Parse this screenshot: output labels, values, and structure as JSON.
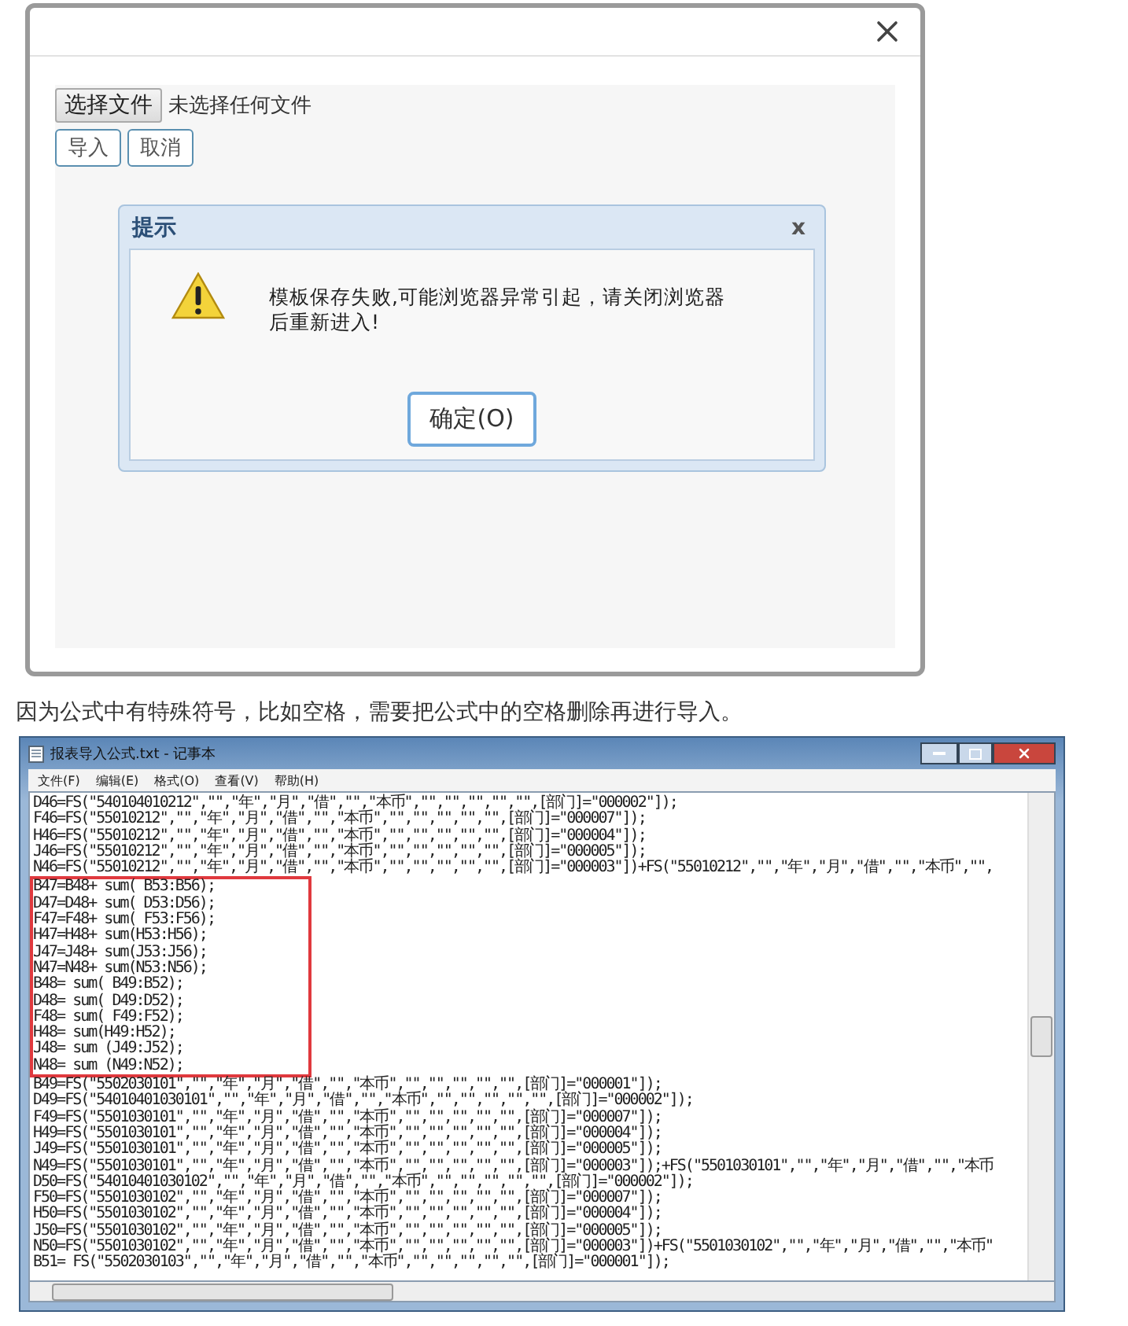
{
  "import_dialog": {
    "file_button": "选择文件",
    "file_status": "未选择任何文件",
    "buttons": [
      "导入",
      "取消"
    ],
    "alert": {
      "title": "提示",
      "close": "x",
      "message": "模板保存失败,可能浏览器异常引起，请关闭浏览器后重新进入!",
      "ok": "确定(O)"
    }
  },
  "caption": "因为公式中有特殊符号，比如空格，需要把公式中的空格删除再进行导入。",
  "notepad": {
    "title": "报表导入公式.txt - 记事本",
    "menu": [
      "文件(F)",
      "编辑(E)",
      "格式(O)",
      "查看(V)",
      "帮助(H)"
    ],
    "blocks": [
      {
        "highlighted": false,
        "lines": [
          "D46=FS(\"540104010212\",\"\",\"年\",\"月\",\"借\",\"\",\"本币\",\"\",\"\",\"\",\"\",\"\",[部门]=\"000002\"]);",
          "F46=FS(\"55010212\",\"\",\"年\",\"月\",\"借\",\"\",\"本币\",\"\",\"\",\"\",\"\",\"\",[部门]=\"000007\"]);",
          "H46=FS(\"55010212\",\"\",\"年\",\"月\",\"借\",\"\",\"本币\",\"\",\"\",\"\",\"\",\"\",[部门]=\"000004\"]);",
          "J46=FS(\"55010212\",\"\",\"年\",\"月\",\"借\",\"\",\"本币\",\"\",\"\",\"\",\"\",\"\",[部门]=\"000005\"]);",
          "N46=FS(\"55010212\",\"\",\"年\",\"月\",\"借\",\"\",\"本币\",\"\",\"\",\"\",\"\",\"\",[部门]=\"000003\"])+FS(\"55010212\",\"\",\"年\",\"月\",\"借\",\"\",\"本币\",\"\","
        ]
      },
      {
        "highlighted": true,
        "lines": [
          "B47=B48+ sum( B53:B56);",
          "D47=D48+ sum( D53:D56);",
          "F47=F48+ sum( F53:F56);",
          "H47=H48+ sum(H53:H56);",
          "J47=J48+ sum(J53:J56);",
          "N47=N48+ sum(N53:N56);",
          "B48= sum( B49:B52);",
          "D48= sum( D49:D52);",
          "F48= sum( F49:F52);",
          "H48= sum(H49:H52);",
          "J48= sum (J49:J52);",
          "N48= sum (N49:N52);"
        ]
      },
      {
        "highlighted": false,
        "lines": [
          "B49=FS(\"5502030101\",\"\",\"年\",\"月\",\"借\",\"\",\"本币\",\"\",\"\",\"\",\"\",\"\",[部门]=\"000001\"]);",
          "D49=FS(\"54010401030101\",\"\",\"年\",\"月\",\"借\",\"\",\"本币\",\"\",\"\",\"\",\"\",\"\",[部门]=\"000002\"]);",
          "F49=FS(\"5501030101\",\"\",\"年\",\"月\",\"借\",\"\",\"本币\",\"\",\"\",\"\",\"\",\"\",[部门]=\"000007\"]);",
          "H49=FS(\"5501030101\",\"\",\"年\",\"月\",\"借\",\"\",\"本币\",\"\",\"\",\"\",\"\",\"\",[部门]=\"000004\"]);",
          "J49=FS(\"5501030101\",\"\",\"年\",\"月\",\"借\",\"\",\"本币\",\"\",\"\",\"\",\"\",\"\",[部门]=\"000005\"]);",
          "N49=FS(\"5501030101\",\"\",\"年\",\"月\",\"借\",\"\",\"本币\",\"\",\"\",\"\",\"\",\"\",[部门]=\"000003\"]);+FS(\"5501030101\",\"\",\"年\",\"月\",\"借\",\"\",\"本币",
          "D50=FS(\"54010401030102\",\"\",\"年\",\"月\",\"借\",\"\",\"本币\",\"\",\"\",\"\",\"\",\"\",[部门]=\"000002\"]);",
          "F50=FS(\"5501030102\",\"\",\"年\",\"月\",\"借\",\"\",\"本币\",\"\",\"\",\"\",\"\",\"\",[部门]=\"000007\"]);",
          "H50=FS(\"5501030102\",\"\",\"年\",\"月\",\"借\",\"\",\"本币\",\"\",\"\",\"\",\"\",\"\",[部门]=\"000004\"]);",
          "J50=FS(\"5501030102\",\"\",\"年\",\"月\",\"借\",\"\",\"本币\",\"\",\"\",\"\",\"\",\"\",[部门]=\"000005\"]);",
          "N50=FS(\"5501030102\",\"\",\"年\",\"月\",\"借\",\"\",\"本币\",\"\",\"\",\"\",\"\",\"\",[部门]=\"000003\"])+FS(\"5501030102\",\"\",\"年\",\"月\",\"借\",\"\",\"本币\"",
          "B51= FS(\"5502030103\",\"\",\"年\",\"月\",\"借\",\"\",\"本币\",\"\",\"\",\"\",\"\",\"\",[部门]=\"000001\"]);"
        ]
      }
    ]
  }
}
